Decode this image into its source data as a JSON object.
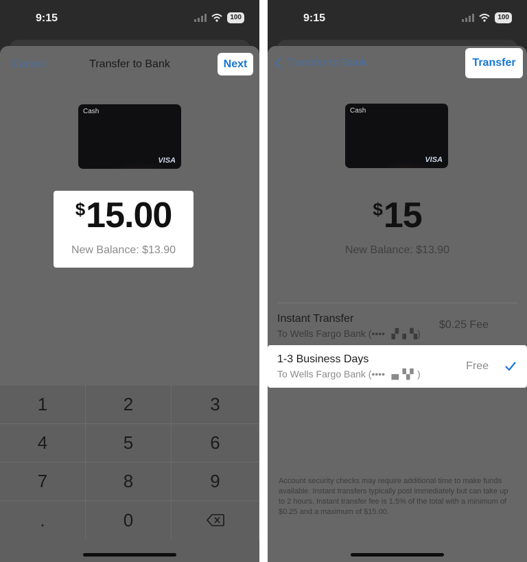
{
  "status_bar": {
    "time": "9:15",
    "battery": "100"
  },
  "left_screen": {
    "nav": {
      "cancel_label": "Cancel",
      "title": "Transfer to Bank",
      "next_label": "Next"
    },
    "card": {
      "label": "Cash",
      "network": "VISA"
    },
    "amount": {
      "currency": "$",
      "value": "15.00"
    },
    "balance": "New Balance: $13.90",
    "keypad": {
      "keys": [
        "1",
        "2",
        "3",
        "4",
        "5",
        "6",
        "7",
        "8",
        "9",
        ".",
        "0"
      ]
    }
  },
  "right_screen": {
    "nav": {
      "back_label": "Transfer to Bank",
      "transfer_label": "Transfer"
    },
    "card": {
      "label": "Cash",
      "network": "VISA"
    },
    "amount": {
      "currency": "$",
      "value": "15"
    },
    "balance": "New Balance: $13.90",
    "options": [
      {
        "title": "Instant Transfer",
        "subtitle": "To Wells Fargo Bank (•••• ▗▘▖▚)",
        "fee": "$0.25 Fee",
        "selected": false
      },
      {
        "title": "1-3 Business Days",
        "subtitle": "To Wells Fargo Bank (•••• ▗▖▚▘)",
        "fee": "Free",
        "selected": true
      }
    ],
    "disclaimer": "Account security checks may require additional time to make funds available. Instant transfers typically post immediately but can take up to 2 hours. Instant transfer fee is 1.5% of the total with a minimum of $0.25 and a maximum of $15.00."
  },
  "colors": {
    "accent": "#1877d2",
    "sheet": "#676767",
    "background": "#2a2a2a"
  }
}
